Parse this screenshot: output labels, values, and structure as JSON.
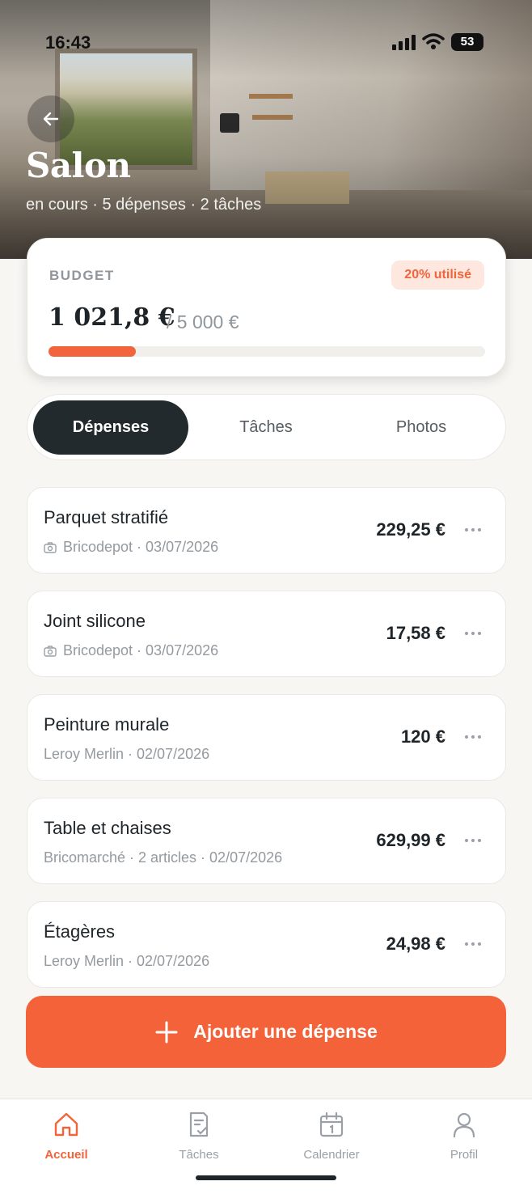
{
  "status": {
    "time": "16:43",
    "battery": "53"
  },
  "room": {
    "title": "Salon",
    "meta": "en cours · 5 dépenses · 2 tâches"
  },
  "budget": {
    "label": "BUDGET",
    "badge": "20% utilisé",
    "spent": "1 021,8 €",
    "total": "/ 5 000 €",
    "progress_fraction": 0.2
  },
  "tabs": [
    {
      "label": "Dépenses",
      "active": true
    },
    {
      "label": "Tâches",
      "active": false
    },
    {
      "label": "Photos",
      "active": false
    }
  ],
  "expenses": [
    {
      "name": "Parquet stratifié",
      "meta": "Bricodepot · 03/07/2026",
      "amount": "229,25 €",
      "has_photo": true
    },
    {
      "name": "Joint silicone",
      "meta": "Bricodepot · 03/07/2026",
      "amount": "17,58 €",
      "has_photo": true
    },
    {
      "name": "Peinture murale",
      "meta": "Leroy Merlin · 02/07/2026",
      "amount": "120 €",
      "has_photo": false
    },
    {
      "name": "Table et chaises",
      "meta": "Bricomarché · 2 articles · 02/07/2026",
      "amount": "629,99 €",
      "has_photo": false
    },
    {
      "name": "Étagères",
      "meta": "Leroy Merlin · 02/07/2026",
      "amount": "24,98 €",
      "has_photo": false
    }
  ],
  "add_button": {
    "label": "Ajouter une dépense"
  },
  "nav": [
    {
      "label": "Accueil",
      "icon": "home-icon",
      "active": true
    },
    {
      "label": "Tâches",
      "icon": "tasks-icon",
      "active": false
    },
    {
      "label": "Calendrier",
      "icon": "calendar-icon",
      "active": false
    },
    {
      "label": "Profil",
      "icon": "profile-icon",
      "active": false
    }
  ],
  "colors": {
    "accent": "#f4623a",
    "dark": "#222a2e",
    "muted": "#9aa0a6"
  }
}
